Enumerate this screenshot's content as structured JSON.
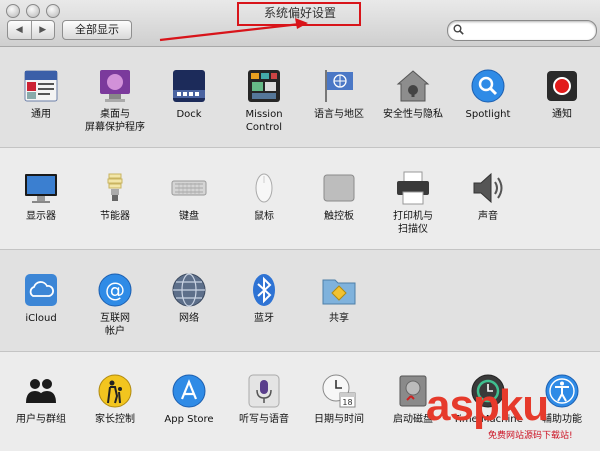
{
  "window": {
    "title": "系统偏好设置"
  },
  "toolbar": {
    "back_glyph": "◀",
    "forward_glyph": "▶",
    "show_all_label": "全部显示",
    "search_placeholder": ""
  },
  "sections": [
    {
      "items": [
        {
          "label": "通用",
          "icon": "general-icon"
        },
        {
          "label": "桌面与\n屏幕保护程序",
          "icon": "desktop-screensaver-icon"
        },
        {
          "label": "Dock",
          "icon": "dock-icon"
        },
        {
          "label": "Mission\nControl",
          "icon": "mission-control-icon"
        },
        {
          "label": "语言与地区",
          "icon": "language-region-icon"
        },
        {
          "label": "安全性与隐私",
          "icon": "security-privacy-icon"
        },
        {
          "label": "Spotlight",
          "icon": "spotlight-icon"
        },
        {
          "label": "通知",
          "icon": "notifications-icon"
        }
      ]
    },
    {
      "items": [
        {
          "label": "显示器",
          "icon": "displays-icon"
        },
        {
          "label": "节能器",
          "icon": "energy-saver-icon"
        },
        {
          "label": "键盘",
          "icon": "keyboard-icon"
        },
        {
          "label": "鼠标",
          "icon": "mouse-icon"
        },
        {
          "label": "触控板",
          "icon": "trackpad-icon"
        },
        {
          "label": "打印机与\n扫描仪",
          "icon": "printers-scanners-icon"
        },
        {
          "label": "声音",
          "icon": "sound-icon"
        }
      ]
    },
    {
      "items": [
        {
          "label": "iCloud",
          "icon": "icloud-icon"
        },
        {
          "label": "互联网\n帐户",
          "icon": "internet-accounts-icon"
        },
        {
          "label": "网络",
          "icon": "network-icon"
        },
        {
          "label": "蓝牙",
          "icon": "bluetooth-icon"
        },
        {
          "label": "共享",
          "icon": "sharing-icon"
        }
      ]
    },
    {
      "items": [
        {
          "label": "用户与群组",
          "icon": "users-groups-icon"
        },
        {
          "label": "家长控制",
          "icon": "parental-controls-icon"
        },
        {
          "label": "App Store",
          "icon": "app-store-icon"
        },
        {
          "label": "听写与语音",
          "icon": "dictation-speech-icon"
        },
        {
          "label": "日期与时间",
          "icon": "date-time-icon"
        },
        {
          "label": "启动磁盘",
          "icon": "startup-disk-icon"
        },
        {
          "label": "Time Machine",
          "icon": "time-machine-icon"
        },
        {
          "label": "辅助功能",
          "icon": "accessibility-icon"
        }
      ]
    }
  ],
  "icon_misc": {
    "calendar_day": "18"
  },
  "watermark": {
    "brand": "aspku",
    "sub": "免费网站源码下载站!"
  },
  "colors": {
    "annotation_red": "#d8141a",
    "watermark_red": "#e63a2b"
  }
}
